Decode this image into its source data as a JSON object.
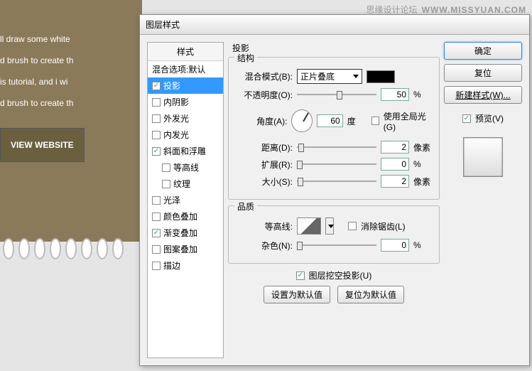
{
  "watermark": {
    "left": "思缘设计论坛",
    "right": "WWW.MISSYUAN.COM"
  },
  "background": {
    "lines": [
      "ll draw some white",
      "d brush to create th",
      "is tutorial, and i wi",
      "d brush to create th"
    ],
    "button": "VIEW WEBSITE"
  },
  "dialog": {
    "title": "图层样式",
    "sidebar": {
      "header": "样式",
      "items": [
        {
          "label": "混合选项:默认",
          "checked": null
        },
        {
          "label": "投影",
          "checked": true,
          "selected": true
        },
        {
          "label": "内阴影",
          "checked": false
        },
        {
          "label": "外发光",
          "checked": false
        },
        {
          "label": "内发光",
          "checked": false
        },
        {
          "label": "斜面和浮雕",
          "checked": true
        },
        {
          "label": "等高线",
          "checked": false,
          "sub": true
        },
        {
          "label": "纹理",
          "checked": false,
          "sub": true
        },
        {
          "label": "光泽",
          "checked": false
        },
        {
          "label": "颜色叠加",
          "checked": false
        },
        {
          "label": "渐变叠加",
          "checked": true
        },
        {
          "label": "图案叠加",
          "checked": false
        },
        {
          "label": "描边",
          "checked": false
        }
      ]
    },
    "panel": {
      "title": "投影",
      "structure": {
        "legend": "结构",
        "blend_label": "混合模式(B):",
        "blend_value": "正片叠底",
        "opacity_label": "不透明度(O):",
        "opacity_value": "50",
        "opacity_unit": "%",
        "angle_label": "角度(A):",
        "angle_value": "60",
        "angle_unit": "度",
        "global_light": "使用全局光(G)",
        "distance_label": "距离(D):",
        "distance_value": "2",
        "distance_unit": "像素",
        "spread_label": "扩展(R):",
        "spread_value": "0",
        "spread_unit": "%",
        "size_label": "大小(S):",
        "size_value": "2",
        "size_unit": "像素"
      },
      "quality": {
        "legend": "品质",
        "contour_label": "等高线:",
        "antialias": "消除锯齿(L)",
        "noise_label": "杂色(N):",
        "noise_value": "0",
        "noise_unit": "%"
      },
      "knockout": "图层挖空投影(U)",
      "set_default": "设置为默认值",
      "reset_default": "复位为默认值"
    },
    "buttons": {
      "ok": "确定",
      "cancel": "复位",
      "new_style": "新建样式(W)...",
      "preview": "预览(V)"
    }
  }
}
